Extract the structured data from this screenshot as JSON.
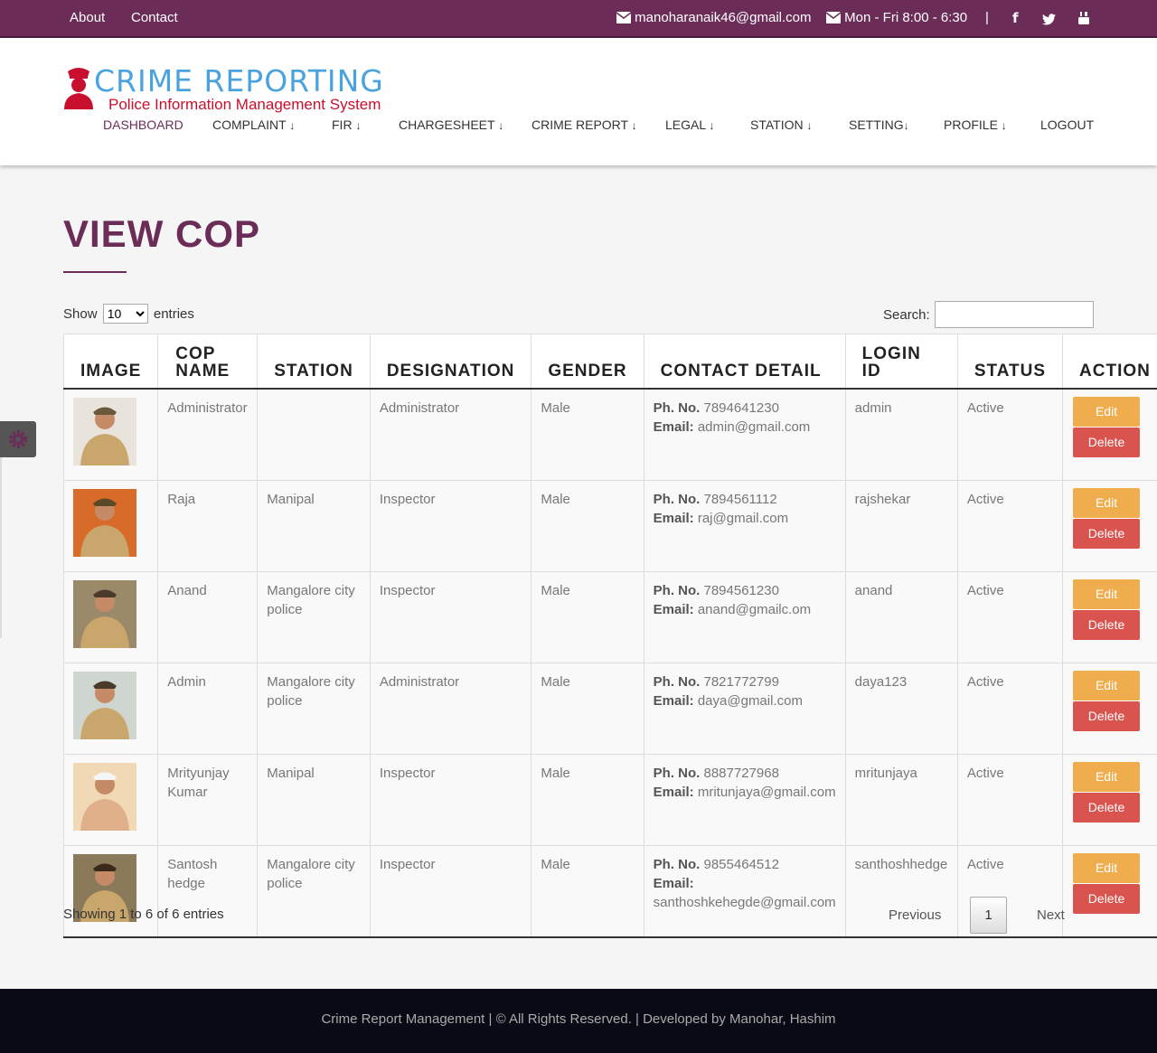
{
  "topbar": {
    "about": "About",
    "contact": "Contact",
    "email": "manoharanaik46@gmail.com",
    "hours": "Mon - Fri 8:00 - 6:30",
    "separator": "|"
  },
  "logo": {
    "title": "CRIME REPORTING",
    "subtitle": "Police Information Management System"
  },
  "nav": [
    "DASHBOARD",
    "COMPLAINT",
    "FIR",
    "CHARGESHEET",
    "CRIME REPORT",
    "LEGAL",
    "STATION",
    "SETTING",
    "PROFILE",
    "LOGOUT"
  ],
  "page": {
    "title": "VIEW COP"
  },
  "controls": {
    "show_label": "Show",
    "entries_value": "10",
    "entries_label": "entries",
    "search_label": "Search:"
  },
  "table": {
    "headers": [
      "IMAGE",
      "COP NAME",
      "STATION",
      "DESIGNATION",
      "GENDER",
      "CONTACT DETAIL",
      "LOGIN ID",
      "STATUS",
      "ACTION"
    ],
    "phone_label": "Ph. No.",
    "email_label": "Email:",
    "edit_label": "Edit",
    "delete_label": "Delete",
    "rows": [
      {
        "name": "Administrator",
        "station": "",
        "designation": "Administrator",
        "gender": "Male",
        "phone": "7894641230",
        "email": "admin@gmail.com",
        "login": "admin",
        "status": "Active"
      },
      {
        "name": "Raja",
        "station": "Manipal",
        "designation": "Inspector",
        "gender": "Male",
        "phone": "7894561112",
        "email": "raj@gmail.com",
        "login": "rajshekar",
        "status": "Active"
      },
      {
        "name": "Anand",
        "station": "Mangalore city police",
        "designation": "Inspector",
        "gender": "Male",
        "phone": "7894561230",
        "email": "anand@gmailc.om",
        "login": "anand",
        "status": "Active"
      },
      {
        "name": "Admin",
        "station": "Mangalore city police",
        "designation": "Administrator",
        "gender": "Male",
        "phone": "7821772799",
        "email": "daya@gmail.com",
        "login": "daya123",
        "status": "Active"
      },
      {
        "name": "Mrityunjay Kumar",
        "station": "Manipal",
        "designation": "Inspector",
        "gender": "Male",
        "phone": "8887727968",
        "email": "mritunjaya@gmail.com",
        "login": "mritunjaya",
        "status": "Active"
      },
      {
        "name": "Santosh hedge",
        "station": "Mangalore city police",
        "designation": "Inspector",
        "gender": "Male",
        "phone": "9855464512",
        "email": "santhoshkehegde@gmail.com",
        "login": "santhoshhedge",
        "status": "Active"
      }
    ]
  },
  "pagination": {
    "showing": "Showing 1 to 6 of 6 entries",
    "previous": "Previous",
    "page": "1",
    "next": "Next"
  },
  "footer": {
    "text": "Crime Report Management | © All Rights Reserved. | Developed by Manohar, Hashim"
  },
  "colors": {
    "brand": "#6b2d58",
    "logo_blue": "#4aa3df",
    "logo_red": "#c8102e",
    "edit": "#f0ad4e",
    "delete": "#d9534f",
    "footer": "#0a0a16"
  }
}
